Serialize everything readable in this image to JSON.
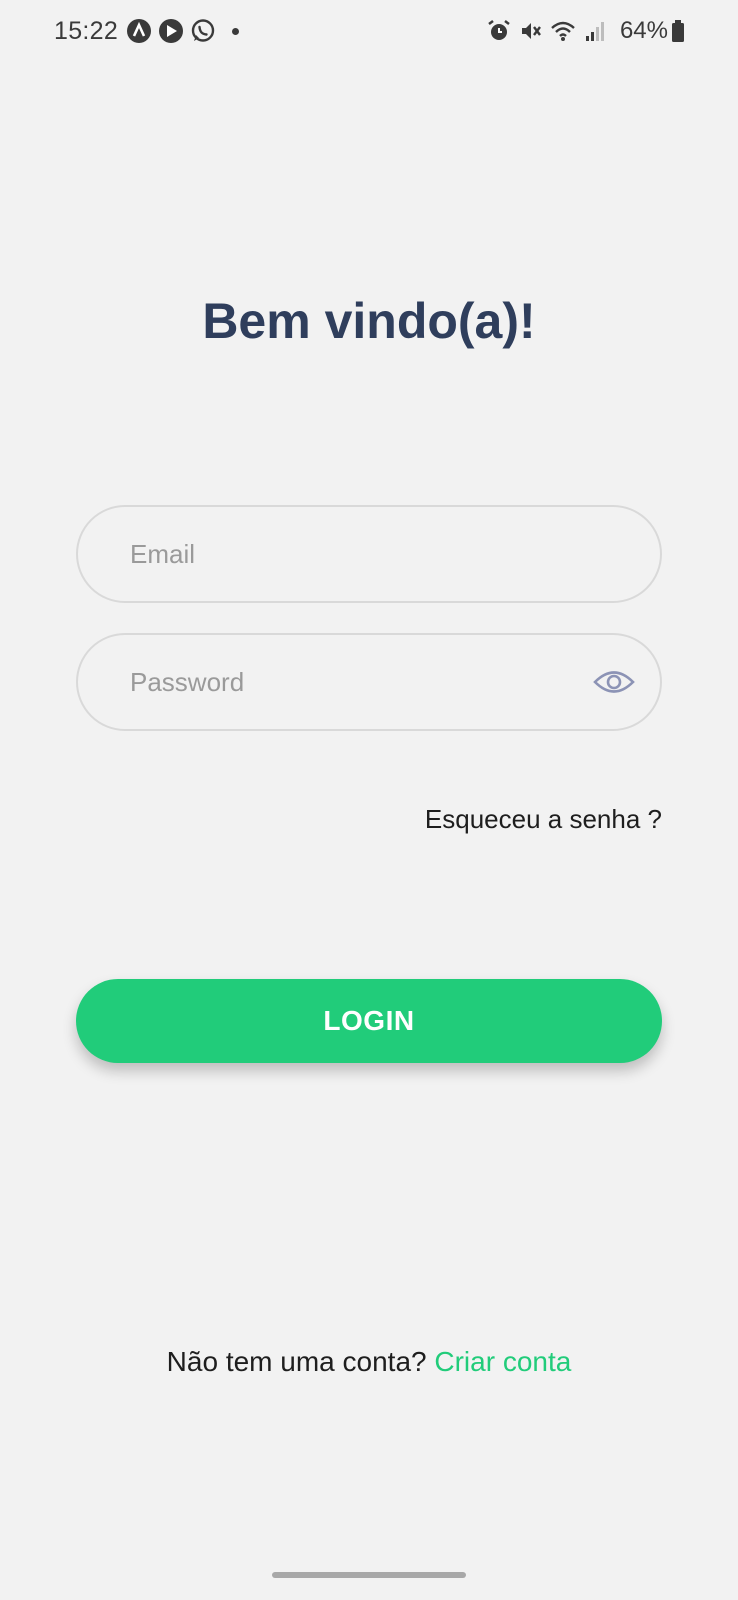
{
  "status_bar": {
    "time": "15:22",
    "left_icons": [
      "app-a-icon",
      "bible-app-icon",
      "whatsapp-icon"
    ],
    "right_icons": [
      "alarm-icon",
      "mute-icon",
      "wifi-icon",
      "signal-icon"
    ],
    "battery": "64%"
  },
  "login": {
    "title": "Bem vindo(a)!",
    "email_placeholder": "Email",
    "password_placeholder": "Password",
    "forgot_password": "Esqueceu a senha ?",
    "login_button": "LOGIN",
    "no_account_text": "Não tem uma conta?",
    "create_account_link": "Criar conta"
  },
  "colors": {
    "accent": "#21cc7a",
    "title": "#2f3e5c",
    "background": "#f2f2f2"
  }
}
